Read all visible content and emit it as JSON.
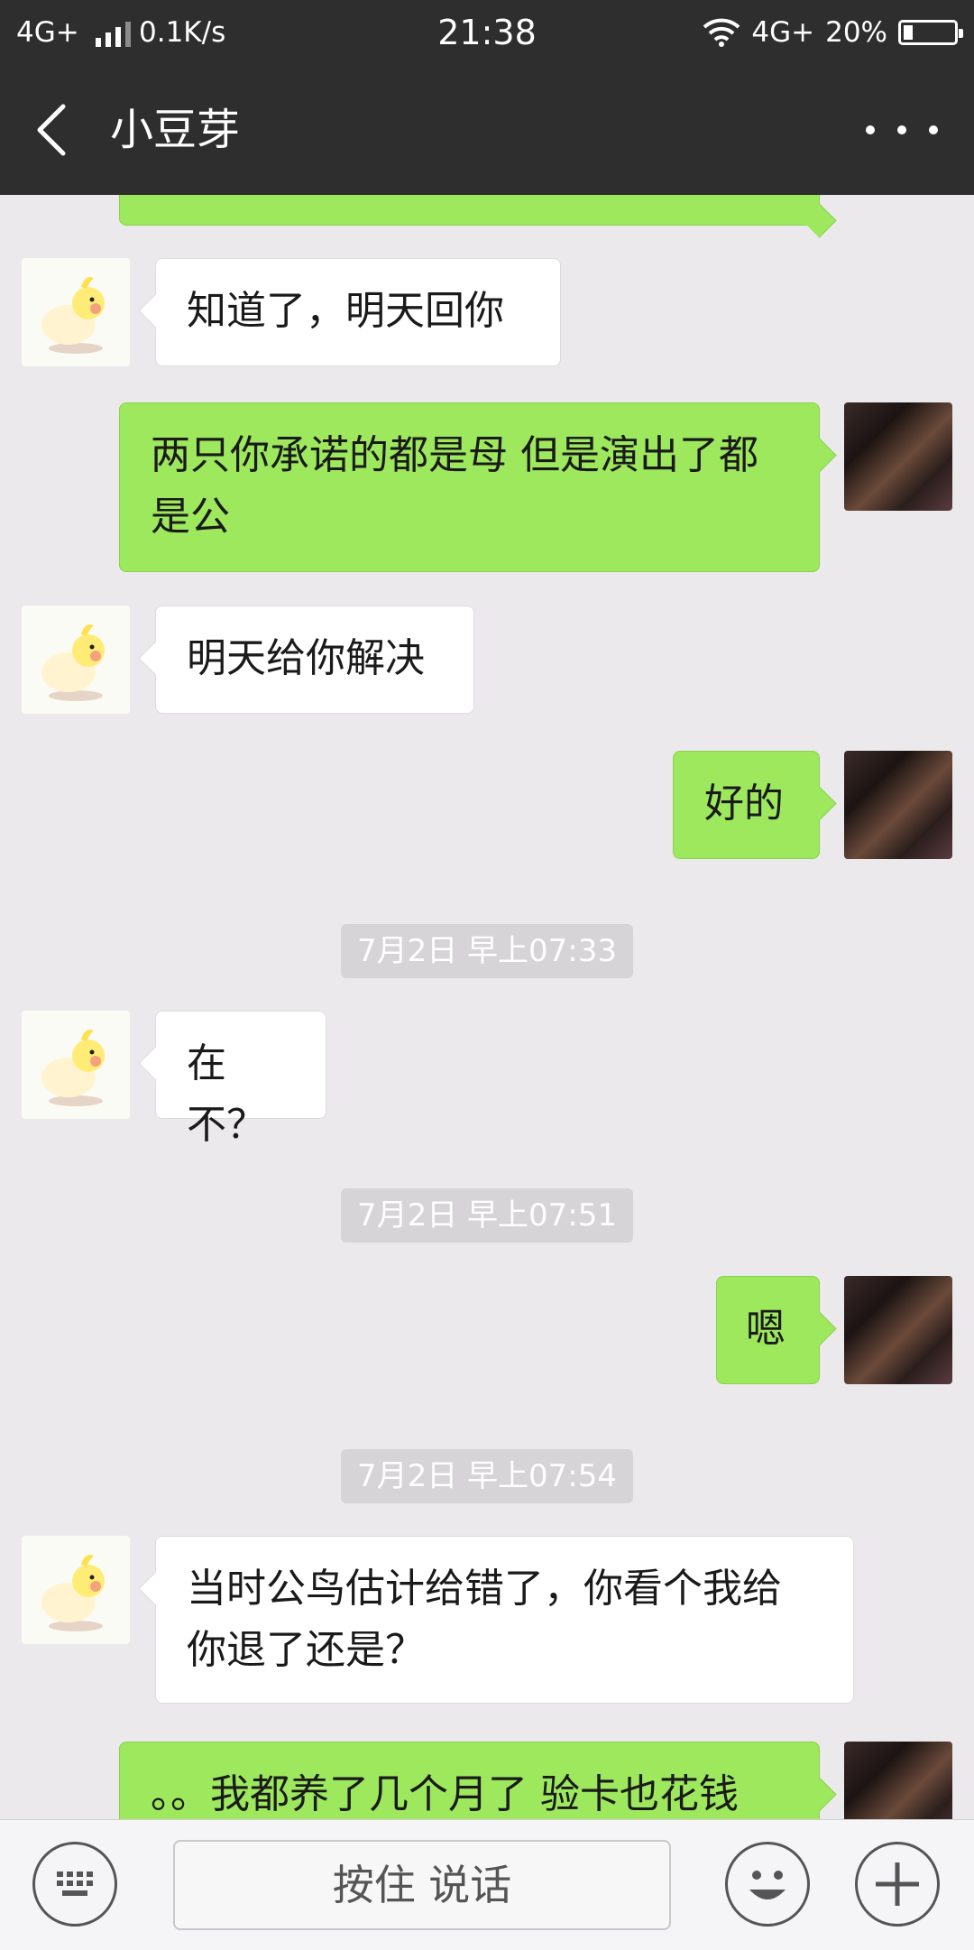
{
  "status_bar": {
    "network_left": "4G+",
    "speed": "0.1K/s",
    "time": "21:38",
    "network_right": "4G+",
    "battery": "20%"
  },
  "header": {
    "title": "小豆芽"
  },
  "messages": [
    {
      "kind": "in",
      "text": "知道了，明天回你"
    },
    {
      "kind": "out",
      "line1": "两只你承诺的都是母 但是演出了都",
      "line2": "是公"
    },
    {
      "kind": "in",
      "text": "明天给你解决"
    },
    {
      "kind": "out",
      "text": "好的"
    },
    {
      "kind": "time",
      "text": "7月2日 早上07:33"
    },
    {
      "kind": "in",
      "text": "在不？"
    },
    {
      "kind": "time",
      "text": "7月2日 早上07:51"
    },
    {
      "kind": "out",
      "text": "嗯"
    },
    {
      "kind": "time",
      "text": "7月2日 早上07:54"
    },
    {
      "kind": "in",
      "line1": "当时公鸟估计给错了，你看个我给",
      "line2": "你退了还是？"
    },
    {
      "kind": "out",
      "text": "。。我都养了几个月了 验卡也花钱"
    }
  ],
  "input_bar": {
    "voice_label": "按住 说话"
  },
  "icons": {
    "back": "chevron-left-icon",
    "more": "more-dots-icon",
    "keyboard": "keyboard-icon",
    "emoji": "smiley-icon",
    "add": "plus-icon"
  },
  "colors": {
    "header_bg": "#2e2e2e",
    "chat_bg": "#ece9ec",
    "outgoing_bubble": "#9de85d",
    "incoming_bubble": "#ffffff"
  }
}
